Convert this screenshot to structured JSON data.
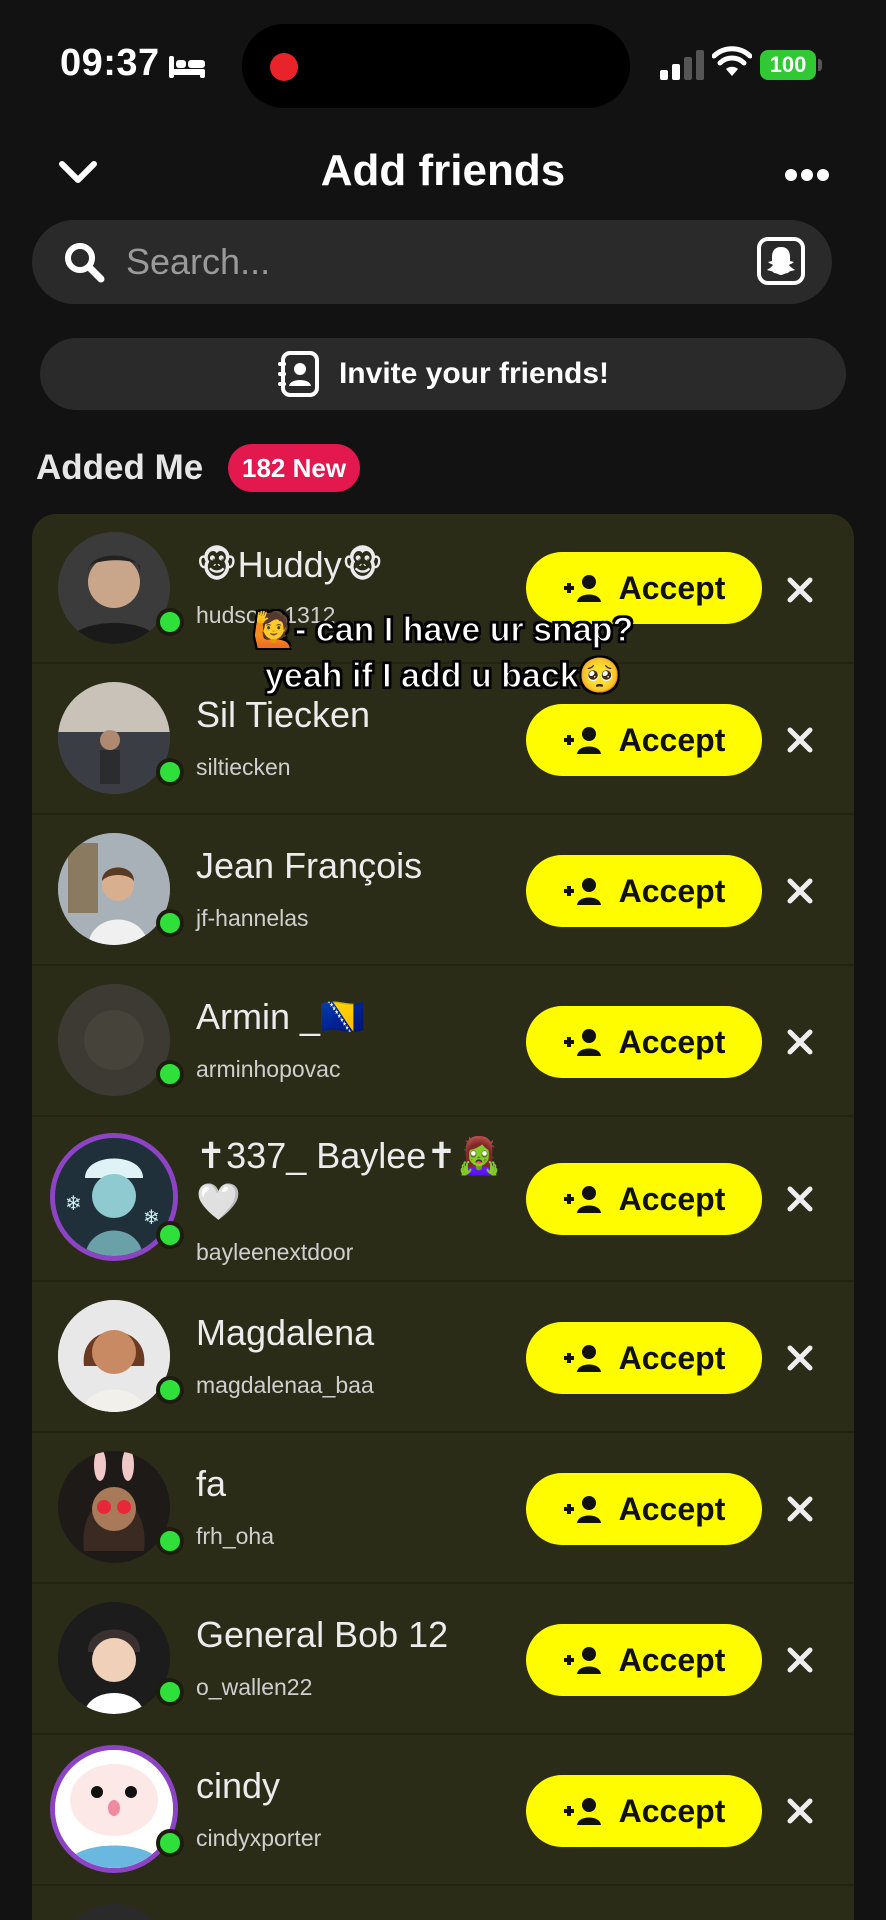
{
  "status_bar": {
    "time": "09:37",
    "battery": "100"
  },
  "header": {
    "title": "Add friends"
  },
  "search": {
    "placeholder": "Search..."
  },
  "invite": {
    "label": "Invite your friends!"
  },
  "section": {
    "title": "Added Me",
    "badge": "182 New"
  },
  "accept_label": "Accept",
  "requests": [
    {
      "name": "🐵Huddy🐵",
      "username": "hudson_1312",
      "avatar_color": "#3b3b3b"
    },
    {
      "name": "Sil Tiecken",
      "username": "siltiecken",
      "avatar_color": "#4a5060"
    },
    {
      "name": "Jean François",
      "username": "jf-hannelas",
      "avatar_color": "#8b8070"
    },
    {
      "name": "Armin _🇧🇦",
      "username": "arminhopovac",
      "avatar_color": "#3a3a30"
    },
    {
      "name": "✝337_ Baylee✝🧟‍♀️",
      "name_line2": "🤍",
      "username": "bayleenextdoor",
      "avatar_color": "#6aa0a8"
    },
    {
      "name": "Magdalena",
      "username": "magdalenaa_baa",
      "avatar_color": "#a0705a"
    },
    {
      "name": "fa",
      "username": "frh_oha",
      "avatar_color": "#2e2622"
    },
    {
      "name": "General Bob 12",
      "username": "o_wallen22",
      "avatar_color": "#f0d0b8"
    },
    {
      "name": "cindy",
      "username": "cindyxporter",
      "avatar_color": "#e8f4f8"
    }
  ],
  "caption": {
    "line1": "🙋- can I have ur snap?",
    "line2": "yeah if I add u back🥺"
  },
  "colors": {
    "accept_yellow": "#fffc00",
    "badge_red": "#e3184f",
    "online_green": "#2fe03a",
    "ring_purple": "#8c44c4"
  }
}
